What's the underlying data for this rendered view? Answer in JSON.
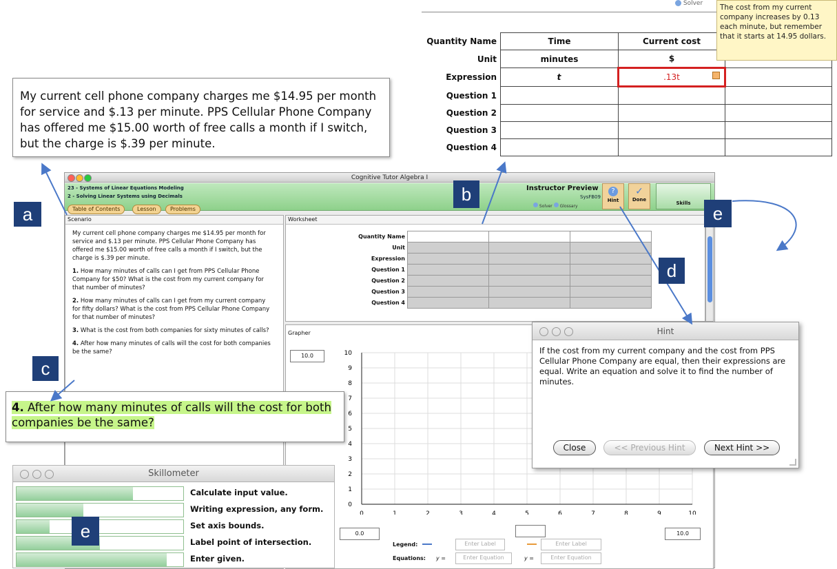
{
  "app": {
    "window_title": "Cognitive Tutor Algebra I",
    "unit_title": "23 - Systems of Linear Equations Modeling",
    "section_title": "2 - Solving Linear Systems using Decimals",
    "tabs": [
      "Table of Contents",
      "Lesson",
      "Problems"
    ],
    "preview_label": "Instructor Preview",
    "problem_id": "SysFB09",
    "solver_label": "Solver",
    "glossary_label": "Glossary",
    "hint_label": "Hint",
    "done_label": "Done",
    "skills_label": "Skills"
  },
  "scenario": {
    "header": "Scenario",
    "intro": "My current cell phone company charges me $14.95 per month for service and $.13 per minute. PPS Cellular Phone Company has offered me $15.00 worth of free calls a month if I switch, but the charge is $.39 per minute.",
    "questions": [
      {
        "num": "1.",
        "text": " How many minutes of calls can I get from PPS Cellular Phone Company for $50? What is the cost from my current company for that number of minutes?"
      },
      {
        "num": "2.",
        "text": " How many minutes of calls can I get from my current company for fifty dollars? What is the cost from PPS Cellular Phone Company for that number of minutes?"
      },
      {
        "num": "3.",
        "text": " What is the cost from both companies for sixty minutes of calls?"
      },
      {
        "num": "4.",
        "text": " After how many minutes of calls will the cost for both companies be the same?"
      }
    ]
  },
  "worksheet": {
    "header": "Worksheet",
    "row_labels": [
      "Quantity Name",
      "Unit",
      "Expression",
      "Question 1",
      "Question 2",
      "Question 3",
      "Question 4"
    ]
  },
  "grapher": {
    "header": "Grapher",
    "y_max_field": "10.0",
    "x_min_field": "0.0",
    "x_max_field": "10.0",
    "legend_label": "Legend:",
    "equations_label": "Equations:",
    "y_eq": "y =",
    "label_placeholder": "Enter Label",
    "equation_placeholder": "Enter Equation"
  },
  "chart_data": {
    "type": "line",
    "x_ticks": [
      "0",
      "1",
      "2",
      "3",
      "4",
      "5",
      "6",
      "7",
      "8",
      "9",
      "10"
    ],
    "y_ticks": [
      "0",
      "1",
      "2",
      "3",
      "4",
      "5",
      "6",
      "7",
      "8",
      "9",
      "10"
    ],
    "xlim": [
      0,
      10
    ],
    "ylim": [
      0,
      10
    ],
    "grid": true,
    "series": []
  },
  "callouts": {
    "a_text": "My current cell phone company charges me $14.95 per month for service and $.13 per minute. PPS Cellular Phone Company has offered me $15.00 worth of free calls a month if I switch, but the charge is $.39 per minute.",
    "c_num": "4.",
    "c_text": " After how many minutes of calls will the cost for both companies be the same?",
    "badges": {
      "a": "a",
      "b": "b",
      "c": "c",
      "d": "d",
      "e": "e"
    }
  },
  "zoom_table": {
    "header_row": {
      "label": "Quantity Name",
      "time": "Time",
      "cost": "Current cost"
    },
    "unit_row": {
      "label": "Unit",
      "time": "minutes",
      "cost": "$"
    },
    "expr_row": {
      "label": "Expression",
      "time": "t",
      "cost": ".13t"
    },
    "question_labels": [
      "Question 1",
      "Question 2",
      "Question 3",
      "Question 4"
    ],
    "solver_label": "Solver",
    "tooltip": "The cost from my current company increases by 0.13 each minute, but remember that it starts at 14.95 dollars.",
    "error_color": "#d42020"
  },
  "hint_window": {
    "title": "Hint",
    "text": "If the cost from my current company and the cost from PPS Cellular Phone Company are equal, then their expressions are equal. Write an equation and solve it to find the number of minutes.",
    "close_label": "Close",
    "prev_label": "<< Previous Hint",
    "next_label": "Next Hint >>"
  },
  "skillometer": {
    "title": "Skillometer",
    "skills": [
      {
        "label": "Calculate input value.",
        "mastery": 0.7
      },
      {
        "label": "Writing expression, any form.",
        "mastery": 0.4
      },
      {
        "label": "Set axis bounds.",
        "mastery": 0.2
      },
      {
        "label": "Label point of intersection.",
        "mastery": 0.5
      },
      {
        "label": "Enter given.",
        "mastery": 0.9
      }
    ]
  },
  "colors": {
    "badge": "#1f3f78",
    "arrow": "#4a78c8",
    "highlight": "#c6f58a",
    "skill_fill": "#94cf9c",
    "header_green": "#8ed18b"
  }
}
